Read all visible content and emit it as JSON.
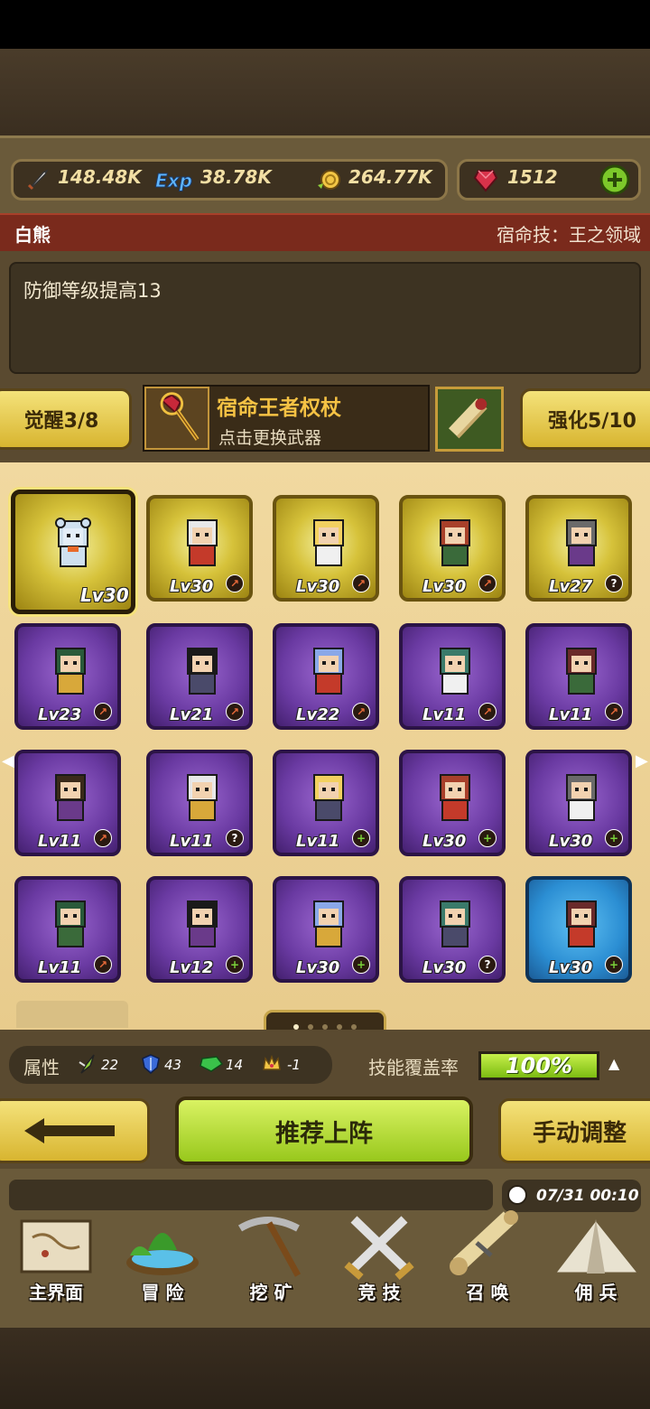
{
  "resources": {
    "attack": "148.48K",
    "exp": "38.78K",
    "coins": "264.77K",
    "gems": "1512"
  },
  "hero": {
    "name": "白熊",
    "fate_skill": "宿命技：王之领域",
    "description": "防御等级提高13"
  },
  "awaken": {
    "label": "觉醒3/8"
  },
  "weapon": {
    "name": "宿命王者权杖",
    "hint": "点击更换武器"
  },
  "enhance": {
    "label": "强化5/10"
  },
  "heroes": [
    {
      "lv": "Lv30",
      "frame": "gold",
      "badge": "none",
      "selected": true,
      "icon": "white-bear-icon"
    },
    {
      "lv": "Lv30",
      "frame": "gold",
      "badge": "sword",
      "icon": "bearded-king-icon"
    },
    {
      "lv": "Lv30",
      "frame": "gold",
      "badge": "sword",
      "icon": "blonde-priestess-icon"
    },
    {
      "lv": "Lv30",
      "frame": "gold",
      "badge": "sword",
      "icon": "red-beard-warrior-icon"
    },
    {
      "lv": "Lv27",
      "frame": "gold",
      "badge": "question",
      "icon": "armored-elder-icon"
    },
    {
      "lv": "Lv23",
      "frame": "purple",
      "badge": "sword",
      "icon": "green-general-icon"
    },
    {
      "lv": "Lv21",
      "frame": "purple",
      "badge": "sword",
      "icon": "pirate-icon"
    },
    {
      "lv": "Lv22",
      "frame": "purple",
      "badge": "sword",
      "icon": "dark-knight-icon"
    },
    {
      "lv": "Lv11",
      "frame": "purple",
      "badge": "sword",
      "icon": "blue-armor-icon"
    },
    {
      "lv": "Lv11",
      "frame": "purple",
      "badge": "sword",
      "icon": "masked-warrior-icon"
    },
    {
      "lv": "Lv11",
      "frame": "purple",
      "badge": "sword",
      "icon": "ice-mage-icon"
    },
    {
      "lv": "Lv11",
      "frame": "purple",
      "badge": "question",
      "icon": "young-fighter-icon"
    },
    {
      "lv": "Lv11",
      "frame": "purple",
      "badge": "plus",
      "icon": "silver-knight-icon"
    },
    {
      "lv": "Lv30",
      "frame": "purple",
      "badge": "plus",
      "icon": "green-ranger-icon"
    },
    {
      "lv": "Lv30",
      "frame": "purple",
      "badge": "plus",
      "icon": "dark-lady-icon"
    },
    {
      "lv": "Lv11",
      "frame": "purple",
      "badge": "sword",
      "icon": "winged-demon-icon"
    },
    {
      "lv": "Lv12",
      "frame": "purple",
      "badge": "plus",
      "icon": "white-hair-rider-icon"
    },
    {
      "lv": "Lv30",
      "frame": "purple",
      "badge": "plus",
      "icon": "black-suit-icon"
    },
    {
      "lv": "Lv30",
      "frame": "purple",
      "badge": "question",
      "icon": "red-robe-icon"
    },
    {
      "lv": "Lv30",
      "frame": "blue",
      "badge": "plus",
      "icon": "dancer-icon"
    }
  ],
  "pager": {
    "total": 5,
    "active": 0
  },
  "attributes": {
    "label": "属性",
    "values": [
      "22",
      "43",
      "14",
      "-1"
    ]
  },
  "coverage": {
    "label": "技能覆盖率",
    "value": "100%",
    "fill": 1.0
  },
  "actions": {
    "recommend": "推荐上阵",
    "manual": "手动调整"
  },
  "clock": "07/31 00:10",
  "nav": [
    {
      "label": "主界面",
      "icon": "map-scroll-icon"
    },
    {
      "label": "冒 险",
      "icon": "island-icon"
    },
    {
      "label": "挖 矿",
      "icon": "pickaxe-icon"
    },
    {
      "label": "竞 技",
      "icon": "crossed-swords-icon"
    },
    {
      "label": "召 唤",
      "icon": "summon-scroll-icon"
    },
    {
      "label": "佣 兵",
      "icon": "tent-icon"
    }
  ]
}
